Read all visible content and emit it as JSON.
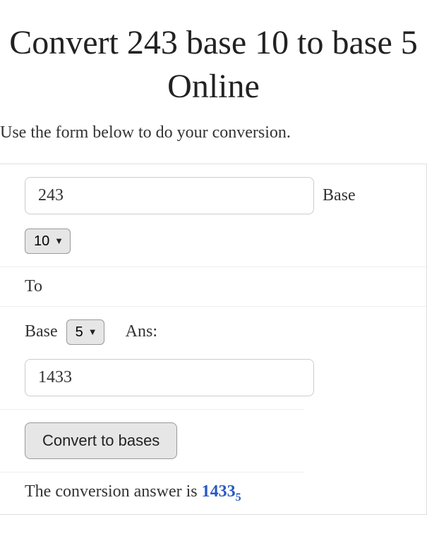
{
  "title": "Convert 243 base 10 to base 5 Online",
  "instruction": "Use the form below to do your conversion.",
  "form": {
    "input_value": "243",
    "base_label": "Base",
    "from_base_selected": "10",
    "to_label": "To",
    "to_base_label": "Base",
    "to_base_selected": "5",
    "ans_label": "Ans:",
    "ans_value": "1433",
    "convert_button": "Convert to bases"
  },
  "answer": {
    "prefix": "The conversion answer is ",
    "value": "1433",
    "subscript": "5"
  }
}
